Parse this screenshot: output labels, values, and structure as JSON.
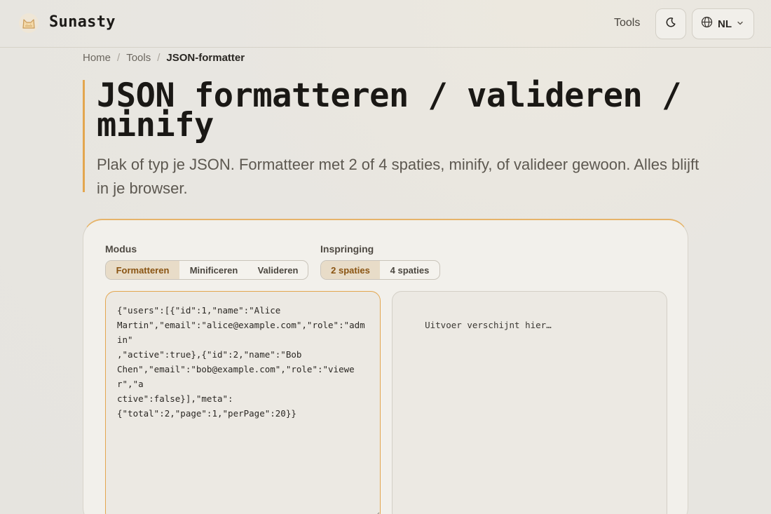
{
  "header": {
    "brand": "Sunasty",
    "nav_tools": "Tools",
    "language": "NL",
    "icons": {
      "logo": "cat-logo-icon",
      "theme": "moon-icon",
      "language": "globe-icon",
      "dropdown": "chevron-down-icon"
    }
  },
  "breadcrumb": {
    "home": "Home",
    "tools": "Tools",
    "current": "JSON-formatter",
    "separator": "/"
  },
  "page": {
    "title_line1": "JSON formatteren / valideren /",
    "title_line2": "minify",
    "subtitle": "Plak of typ je JSON. Formatteer met 2 of 4 spaties, minify, of valideer gewoon. Alles blijft in je browser."
  },
  "controls": {
    "mode_label": "Modus",
    "modes": [
      "Formatteren",
      "Minificeren",
      "Valideren"
    ],
    "active_mode": "Formatteren",
    "indent_label": "Inspringing",
    "indents": [
      "2 spaties",
      "4 spaties"
    ],
    "active_indent": "2 spaties"
  },
  "editor": {
    "input_value": "{\"users\":[{\"id\":1,\"name\":\"Alice Martin\",\"email\":\"alice@example.com\",\"role\":\"admin\",\"active\":true},{\"id\":2,\"name\":\"Bob Chen\",\"email\":\"bob@example.com\",\"role\":\"viewer\",\"active\":false}],\"meta\":{\"total\":2,\"page\":1,\"perPage\":20}}",
    "input_display_lines": [
      "{\"users\":[{\"id\":1,\"name\":\"Alice",
      "Martin\",\"email\":\"alice@example.com\",\"role\":\"admin\"",
      ",\"active\":true},{\"id\":2,\"name\":\"Bob",
      "Chen\",\"email\":\"bob@example.com\",\"role\":\"viewer\",\"a",
      "ctive\":false}],\"meta\":",
      "{\"total\":2,\"page\":1,\"perPage\":20}}"
    ],
    "output_placeholder": "Uitvoer verschijnt hier…"
  },
  "colors": {
    "accent": "#e3a64f",
    "active_segment_bg": "#e8dcc8",
    "active_segment_text": "#8a5412",
    "card_bg": "#f2f0eb",
    "page_bg": "#e8e6e1"
  }
}
